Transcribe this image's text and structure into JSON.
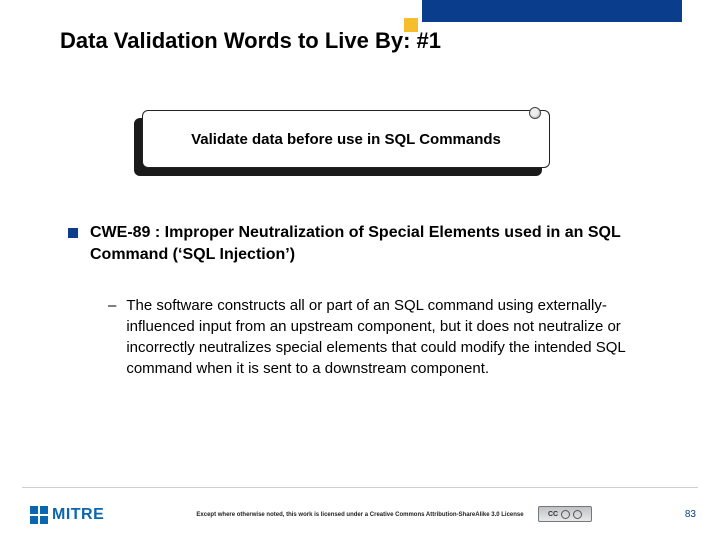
{
  "accent": {
    "bar_color": "#0a3e8c",
    "square_color": "#f6be2a"
  },
  "title": "Data Validation Words to Live By: #1",
  "callout": {
    "text": "Validate data before use in SQL Commands"
  },
  "bullet": {
    "main": "CWE-89 : Improper Neutralization of Special Elements used in an SQL Command (‘SQL Injection’)",
    "sub": "The software constructs all or part of an SQL command using externally-influenced input from an upstream component, but it does not neutralize or incorrectly neutralizes special elements that could modify the intended SQL command when it is sent to a downstream component."
  },
  "footer": {
    "logo_text": "MITRE",
    "license_text": "Except where otherwise noted, this work is licensed under a Creative Commons Attribution-ShareAlike 3.0 License",
    "cc_label": "CC",
    "page_number": "83"
  }
}
